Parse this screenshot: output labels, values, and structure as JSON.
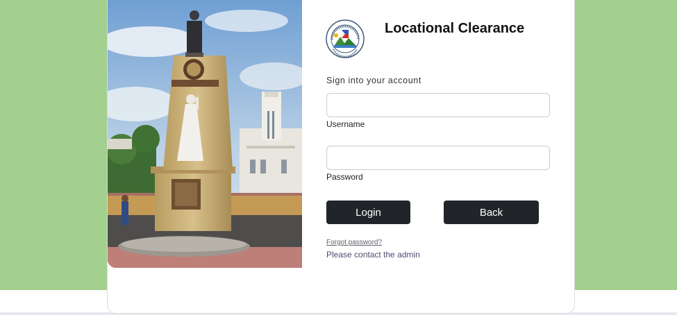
{
  "page": {
    "background_color": "#a3cf8f",
    "accent_color": "#212529"
  },
  "photo": {
    "alt": "Rizal monument photo"
  },
  "logo": {
    "icon": "municipality-seal-icon",
    "seal_text": "MUNICIPALITY OF SAMAL"
  },
  "form": {
    "title": "Locational Clearance",
    "subtitle": "Sign into your account",
    "username": {
      "label": "Username",
      "value": "",
      "placeholder": ""
    },
    "password": {
      "label": "Password",
      "value": "",
      "placeholder": ""
    },
    "login_label": "Login",
    "back_label": "Back",
    "forgot_label": "Forgot password?",
    "contact_text": "Please contact the admin"
  }
}
